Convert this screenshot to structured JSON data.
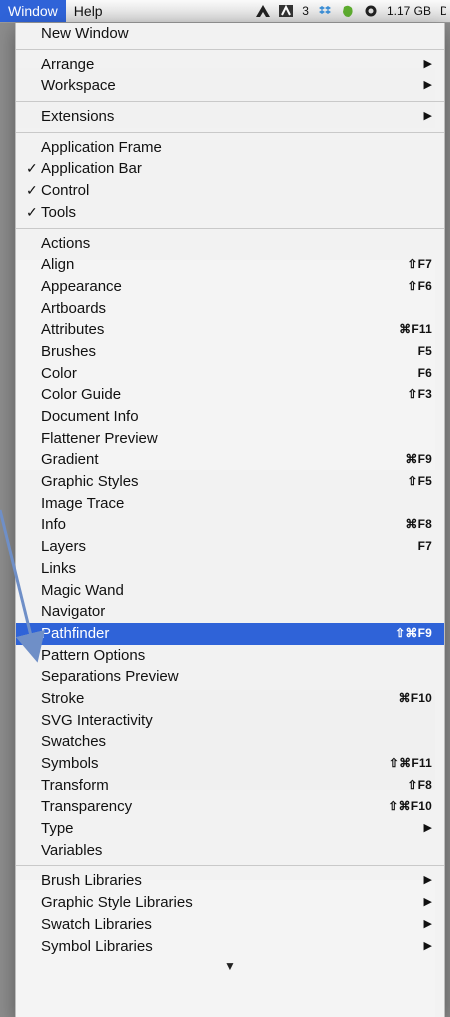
{
  "menubar": {
    "window": "Window",
    "help": "Help",
    "status": {
      "creative_cloud_icon": "adobe-cloud-icon",
      "adobe_count": "3",
      "memory": "1.17 GB",
      "trailing": "D"
    }
  },
  "menu": {
    "group1": [
      {
        "label": "New Window",
        "shortcut": "",
        "submenu": false,
        "checked": false
      }
    ],
    "group2": [
      {
        "label": "Arrange",
        "shortcut": "",
        "submenu": true,
        "checked": false
      },
      {
        "label": "Workspace",
        "shortcut": "",
        "submenu": true,
        "checked": false
      }
    ],
    "group3": [
      {
        "label": "Extensions",
        "shortcut": "",
        "submenu": true,
        "checked": false
      }
    ],
    "group4": [
      {
        "label": "Application Frame",
        "shortcut": "",
        "submenu": false,
        "checked": false
      },
      {
        "label": "Application Bar",
        "shortcut": "",
        "submenu": false,
        "checked": true
      },
      {
        "label": "Control",
        "shortcut": "",
        "submenu": false,
        "checked": true
      },
      {
        "label": "Tools",
        "shortcut": "",
        "submenu": false,
        "checked": true
      }
    ],
    "group5": [
      {
        "label": "Actions",
        "shortcut": "",
        "submenu": false,
        "checked": false
      },
      {
        "label": "Align",
        "shortcut": "⇧F7",
        "submenu": false,
        "checked": false
      },
      {
        "label": "Appearance",
        "shortcut": "⇧F6",
        "submenu": false,
        "checked": false
      },
      {
        "label": "Artboards",
        "shortcut": "",
        "submenu": false,
        "checked": false
      },
      {
        "label": "Attributes",
        "shortcut": "⌘F11",
        "submenu": false,
        "checked": false
      },
      {
        "label": "Brushes",
        "shortcut": "F5",
        "submenu": false,
        "checked": false
      },
      {
        "label": "Color",
        "shortcut": "F6",
        "submenu": false,
        "checked": false
      },
      {
        "label": "Color Guide",
        "shortcut": "⇧F3",
        "submenu": false,
        "checked": false
      },
      {
        "label": "Document Info",
        "shortcut": "",
        "submenu": false,
        "checked": false
      },
      {
        "label": "Flattener Preview",
        "shortcut": "",
        "submenu": false,
        "checked": false
      },
      {
        "label": "Gradient",
        "shortcut": "⌘F9",
        "submenu": false,
        "checked": false
      },
      {
        "label": "Graphic Styles",
        "shortcut": "⇧F5",
        "submenu": false,
        "checked": false
      },
      {
        "label": "Image Trace",
        "shortcut": "",
        "submenu": false,
        "checked": false
      },
      {
        "label": "Info",
        "shortcut": "⌘F8",
        "submenu": false,
        "checked": false
      },
      {
        "label": "Layers",
        "shortcut": "F7",
        "submenu": false,
        "checked": false
      },
      {
        "label": "Links",
        "shortcut": "",
        "submenu": false,
        "checked": false
      },
      {
        "label": "Magic Wand",
        "shortcut": "",
        "submenu": false,
        "checked": false
      },
      {
        "label": "Navigator",
        "shortcut": "",
        "submenu": false,
        "checked": false
      },
      {
        "label": "Pathfinder",
        "shortcut": "⇧⌘F9",
        "submenu": false,
        "checked": false,
        "highlighted": true
      },
      {
        "label": "Pattern Options",
        "shortcut": "",
        "submenu": false,
        "checked": false
      },
      {
        "label": "Separations Preview",
        "shortcut": "",
        "submenu": false,
        "checked": false
      },
      {
        "label": "Stroke",
        "shortcut": "⌘F10",
        "submenu": false,
        "checked": false
      },
      {
        "label": "SVG Interactivity",
        "shortcut": "",
        "submenu": false,
        "checked": false
      },
      {
        "label": "Swatches",
        "shortcut": "",
        "submenu": false,
        "checked": false
      },
      {
        "label": "Symbols",
        "shortcut": "⇧⌘F11",
        "submenu": false,
        "checked": false
      },
      {
        "label": "Transform",
        "shortcut": "⇧F8",
        "submenu": false,
        "checked": false
      },
      {
        "label": "Transparency",
        "shortcut": "⇧⌘F10",
        "submenu": false,
        "checked": false
      },
      {
        "label": "Type",
        "shortcut": "",
        "submenu": true,
        "checked": false
      },
      {
        "label": "Variables",
        "shortcut": "",
        "submenu": false,
        "checked": false
      }
    ],
    "group6": [
      {
        "label": "Brush Libraries",
        "shortcut": "",
        "submenu": true,
        "checked": false
      },
      {
        "label": "Graphic Style Libraries",
        "shortcut": "",
        "submenu": true,
        "checked": false
      },
      {
        "label": "Swatch Libraries",
        "shortcut": "",
        "submenu": true,
        "checked": false
      },
      {
        "label": "Symbol Libraries",
        "shortcut": "",
        "submenu": true,
        "checked": false
      }
    ],
    "scroll_down_glyph": "▼",
    "check_glyph": "✓",
    "submenu_glyph": "▶"
  },
  "colors": {
    "highlight": "#2f63d8",
    "annotation_arrow": "#6f8fc7"
  }
}
